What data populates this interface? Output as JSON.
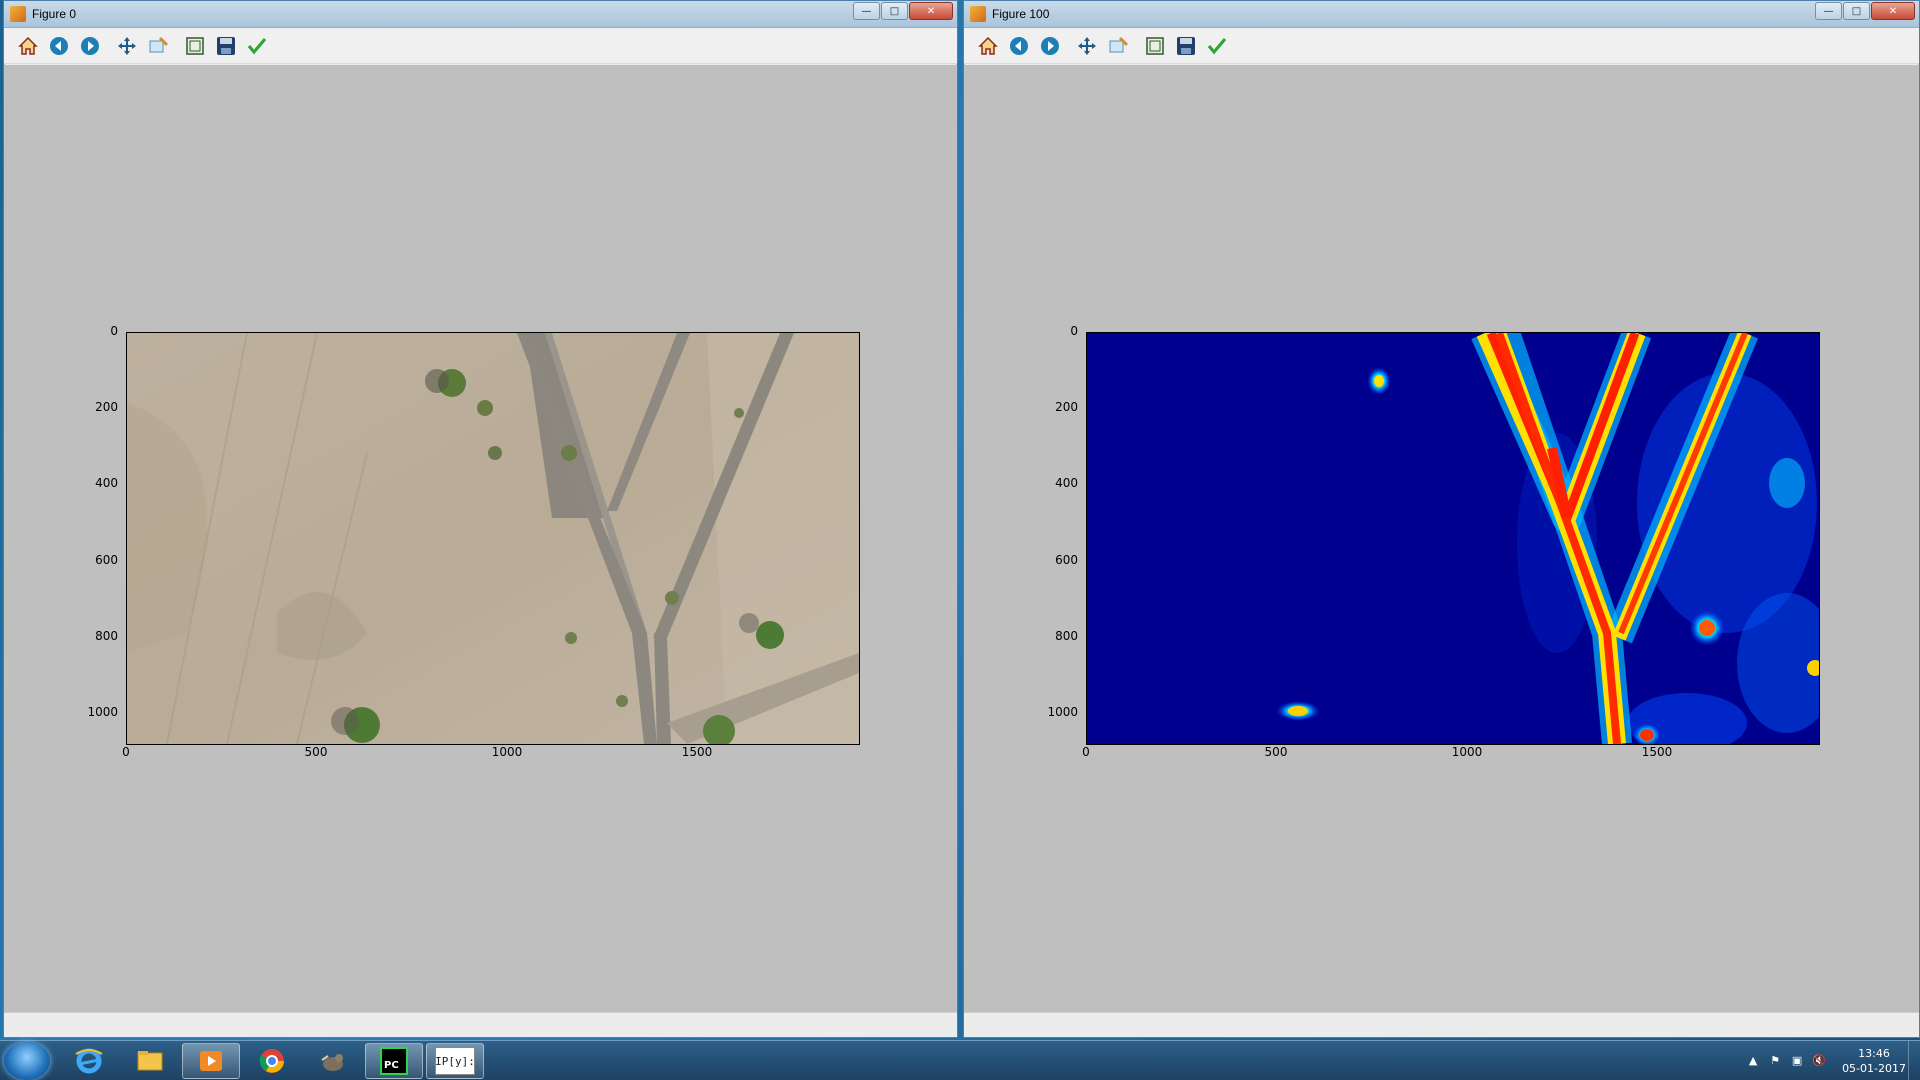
{
  "windows": [
    {
      "title": "Figure 0",
      "y_ticks": [
        "0",
        "200",
        "400",
        "600",
        "800",
        "1000"
      ],
      "x_ticks": [
        "0",
        "500",
        "1000",
        "1500"
      ]
    },
    {
      "title": "Figure 100",
      "y_ticks": [
        "0",
        "200",
        "400",
        "600",
        "800",
        "1000"
      ],
      "x_ticks": [
        "0",
        "500",
        "1000",
        "1500"
      ]
    }
  ],
  "toolbar_icons": [
    "home-icon",
    "back-icon",
    "forward-icon",
    "pan-icon",
    "zoom-icon",
    "subplots-icon",
    "save-icon",
    "edit-check-icon"
  ],
  "taskbar": {
    "apps": [
      "internet-explorer-icon",
      "file-explorer-icon",
      "media-player-icon",
      "chrome-icon",
      "gimp-icon",
      "pycharm-icon",
      "ipython-icon"
    ],
    "pycharm_label": "PC",
    "ipython_label": "IP[y]:",
    "clock_time": "13:46",
    "clock_date": "05-01-2017"
  },
  "colors": {
    "figure_bg": "#bfbfbf",
    "heatmap_low": "#00008f",
    "heatmap_high": "#ff2000"
  }
}
